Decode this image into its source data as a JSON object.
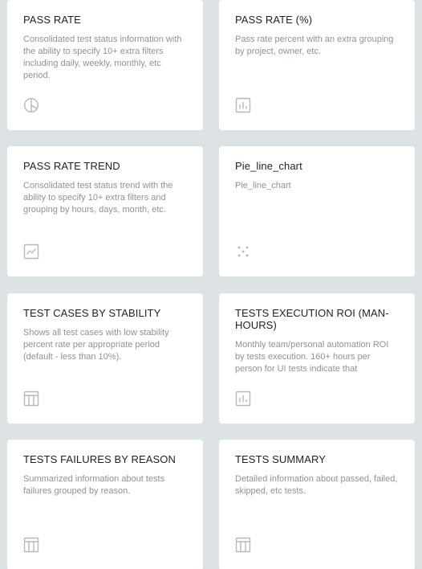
{
  "widgets": [
    {
      "title": "PASS RATE",
      "description": "Consolidated test status information with the ability to specify 10+ extra filters including daily, weekly, monthly, etc period.",
      "icon": "pie-chart-icon"
    },
    {
      "title": "PASS RATE (%)",
      "description": "Pass rate percent with an extra grouping by project, owner, etc.",
      "icon": "bar-chart-icon"
    },
    {
      "title": "PASS RATE TREND",
      "description": "Consolidated test status trend with the ability to specify 10+ extra filters and grouping by hours, days, month, etc.",
      "icon": "line-chart-icon"
    },
    {
      "title": "Pie_line_chart",
      "description": "Pie_line_chart",
      "icon": "scatter-dots-icon"
    },
    {
      "title": "TEST CASES BY STABILITY",
      "description": "Shows all test cases with low stability percent rate per appropriate period (default - less than 10%).",
      "icon": "table-icon"
    },
    {
      "title": "TESTS EXECUTION ROI (MAN-HOURS)",
      "description": "Monthly team/personal automation ROI by tests execution. 160+ hours per person for UI tests indicate that",
      "icon": "bar-chart-icon"
    },
    {
      "title": "TESTS FAILURES BY REASON",
      "description": "Summarized information about tests failures grouped by reason.",
      "icon": "table-icon"
    },
    {
      "title": "TESTS SUMMARY",
      "description": "Detailed information about passed, failed, skipped, etc tests.",
      "icon": "table-icon"
    }
  ]
}
